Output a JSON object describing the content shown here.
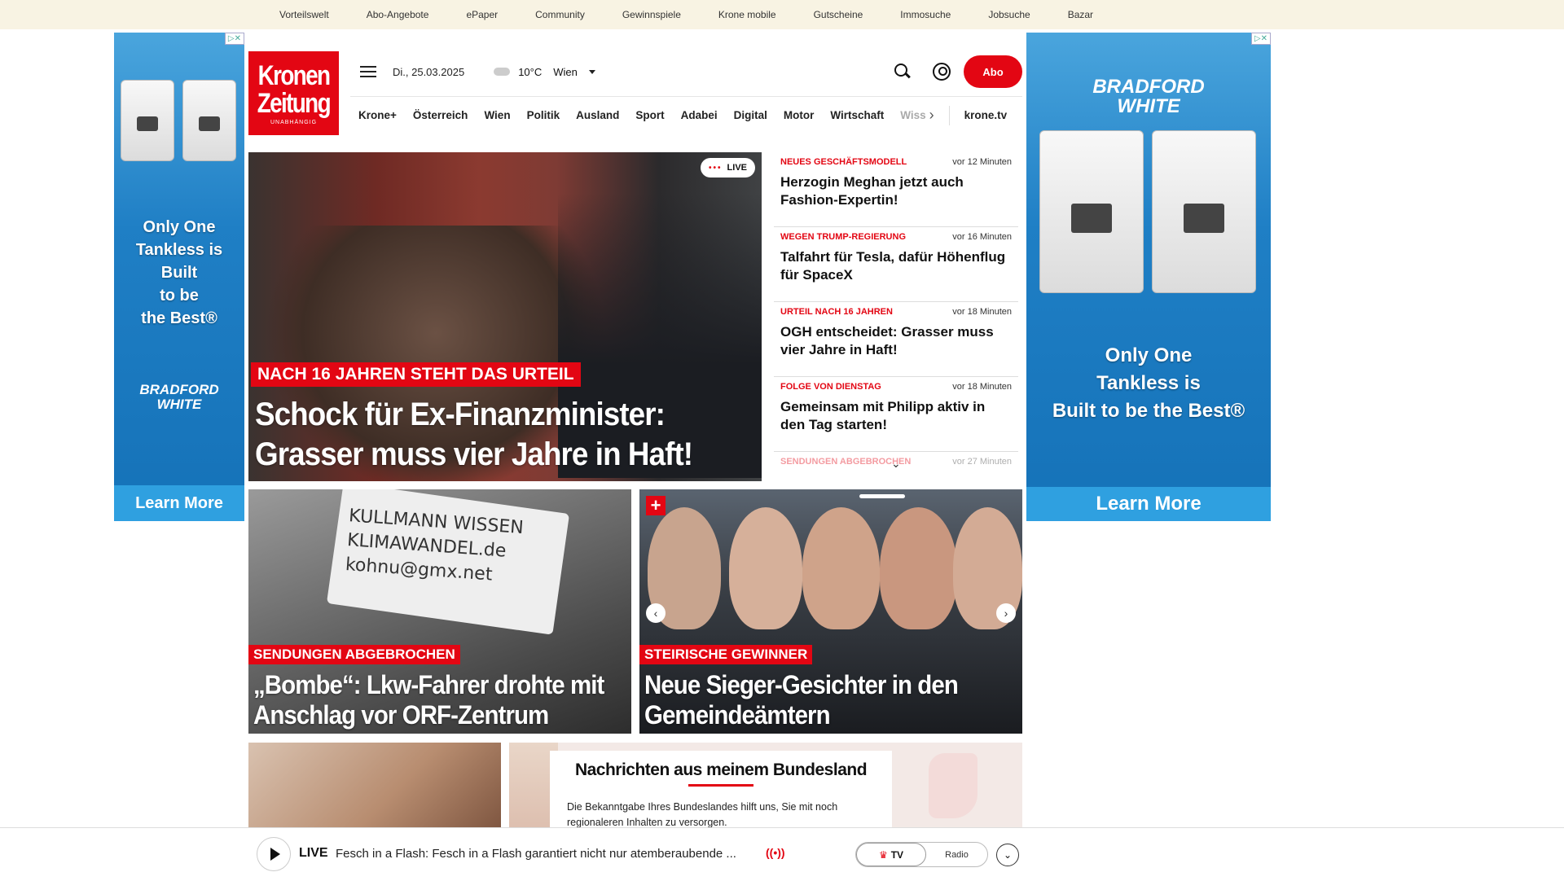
{
  "topnav": [
    "Vorteilswelt",
    "Abo-Angebote",
    "ePaper",
    "Community",
    "Gewinnspiele",
    "Krone mobile",
    "Gutscheine",
    "Immosuche",
    "Jobsuche",
    "Bazar"
  ],
  "logo": {
    "line1": "Kronen",
    "line2": "Zeitung",
    "line3": "UNABHÄNGIG"
  },
  "header": {
    "date": "Di., 25.03.2025",
    "temperature": "10°C",
    "location": "Wien",
    "abo_label": "Abo"
  },
  "nav": {
    "items": [
      "Krone+",
      "Österreich",
      "Wien",
      "Politik",
      "Ausland",
      "Sport",
      "Adabei",
      "Digital",
      "Motor",
      "Wirtschaft"
    ],
    "partial": "Wiss",
    "krone_tv": "krone.tv"
  },
  "ads": {
    "left": {
      "tagline": [
        "Only One",
        "Tankless is",
        "Built",
        "to be",
        "the Best®"
      ],
      "brand": [
        "BRADFORD",
        "WHITE"
      ],
      "cta": "Learn More"
    },
    "right": {
      "tagline": [
        "Only One",
        "Tankless is",
        "Built to be the Best®"
      ],
      "brand": [
        "BRADFORD",
        "WHITE"
      ],
      "cta": "Learn More"
    }
  },
  "hero": {
    "live_label": "LIVE",
    "kicker": "NACH 16 JAHREN STEHT DAS URTEIL",
    "headline": "Schock für Ex-Finanzminister: Grasser muss vier Jahre in Haft!"
  },
  "ticker": [
    {
      "kicker": "NEUES GESCHÄFTSMODELL",
      "time": "vor 12 Minuten",
      "title": "Herzogin Meghan jetzt auch Fashion-Expertin!"
    },
    {
      "kicker": "WEGEN TRUMP-REGIERUNG",
      "time": "vor 16 Minuten",
      "title": "Talfahrt für Tesla, dafür Höhenflug für SpaceX"
    },
    {
      "kicker": "URTEIL NACH 16 JAHREN",
      "time": "vor 18 Minuten",
      "title": "OGH entscheidet: Grasser muss vier Jahre in Haft!"
    },
    {
      "kicker": "FOLGE VON DIENSTAG",
      "time": "vor 18 Minuten",
      "title": "Gemeinsam mit Philipp aktiv in den Tag starten!"
    },
    {
      "kicker": "SENDUNGEN ABGEBROCHEN",
      "time": "vor 27 Minuten",
      "title": ""
    }
  ],
  "teasers": [
    {
      "kicker": "SENDUNGEN ABGEBROCHEN",
      "headline": "„Bombe“: Lkw-Fahrer drohte mit Anschlag vor ORF-Zentrum",
      "truck_text": [
        "KULLMANN WISSEN",
        "KLIMAWANDEL.de",
        "kohnu@gmx.net"
      ]
    },
    {
      "kicker": "STEIRISCHE GEWINNER",
      "headline": "Neue Sieger-Gesichter in den Gemeindeämtern"
    }
  ],
  "modal": {
    "title": "Nachrichten aus meinem Bundesland",
    "text": "Die Bekanntgabe Ihres Bundeslandes hilft uns, Sie mit noch regionaleren Inhalten zu versorgen."
  },
  "player": {
    "live": "LIVE",
    "text": "Fesch in a Flash: Fesch in a Flash garantiert nicht nur atemberaubende ...",
    "tv": "TV",
    "radio": "Radio"
  },
  "colors": {
    "brand_red": "#e30613",
    "topbar_bg": "#f8f3e3",
    "ad_blue": "#1f7fc5"
  }
}
